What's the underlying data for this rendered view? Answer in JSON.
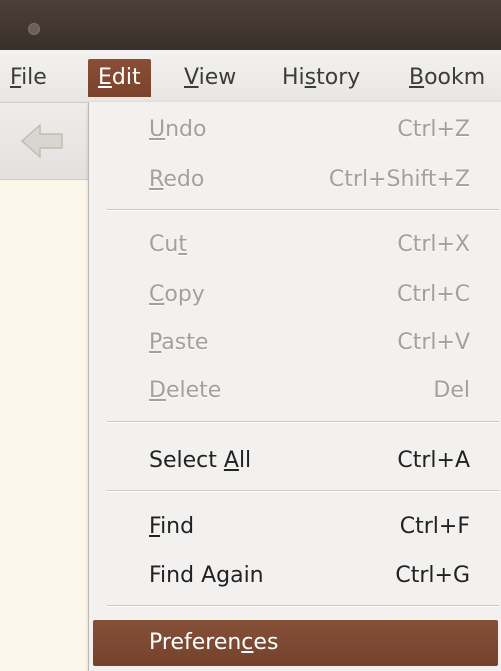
{
  "menubar": {
    "items": [
      {
        "label": "File",
        "mnemonic_index": 0
      },
      {
        "label": "Edit",
        "mnemonic_index": 0
      },
      {
        "label": "View",
        "mnemonic_index": 0
      },
      {
        "label": "History",
        "mnemonic_index": 2
      },
      {
        "label": "Bookm",
        "mnemonic_index": 0
      }
    ],
    "active": "Edit"
  },
  "toolbar": {
    "back_icon": "back-arrow-icon"
  },
  "edit_menu": {
    "items": [
      {
        "label": "Undo",
        "accel": "Ctrl+Z",
        "enabled": false,
        "mnemonic_index": 0
      },
      {
        "label": "Redo",
        "accel": "Ctrl+Shift+Z",
        "enabled": false,
        "mnemonic_index": 0
      },
      {
        "label": "Cut",
        "accel": "Ctrl+X",
        "enabled": false,
        "mnemonic_index": 2
      },
      {
        "label": "Copy",
        "accel": "Ctrl+C",
        "enabled": false,
        "mnemonic_index": 0
      },
      {
        "label": "Paste",
        "accel": "Ctrl+V",
        "enabled": false,
        "mnemonic_index": 0
      },
      {
        "label": "Delete",
        "accel": "Del",
        "enabled": false,
        "mnemonic_index": 0
      },
      {
        "label": "Select All",
        "accel": "Ctrl+A",
        "enabled": true,
        "mnemonic_index": 7
      },
      {
        "label": "Find",
        "accel": "Ctrl+F",
        "enabled": true,
        "mnemonic_index": 0
      },
      {
        "label": "Find Again",
        "accel": "Ctrl+G",
        "enabled": true,
        "mnemonic_index": -1
      },
      {
        "label": "Preferences",
        "accel": "",
        "enabled": true,
        "mnemonic_index": 8
      }
    ],
    "highlighted": "Preferences"
  },
  "colors": {
    "titlebar": "#3e332d",
    "highlight": "#7d4830",
    "menu_bg": "#f2f1f0",
    "disabled_text": "#a4a09c"
  }
}
